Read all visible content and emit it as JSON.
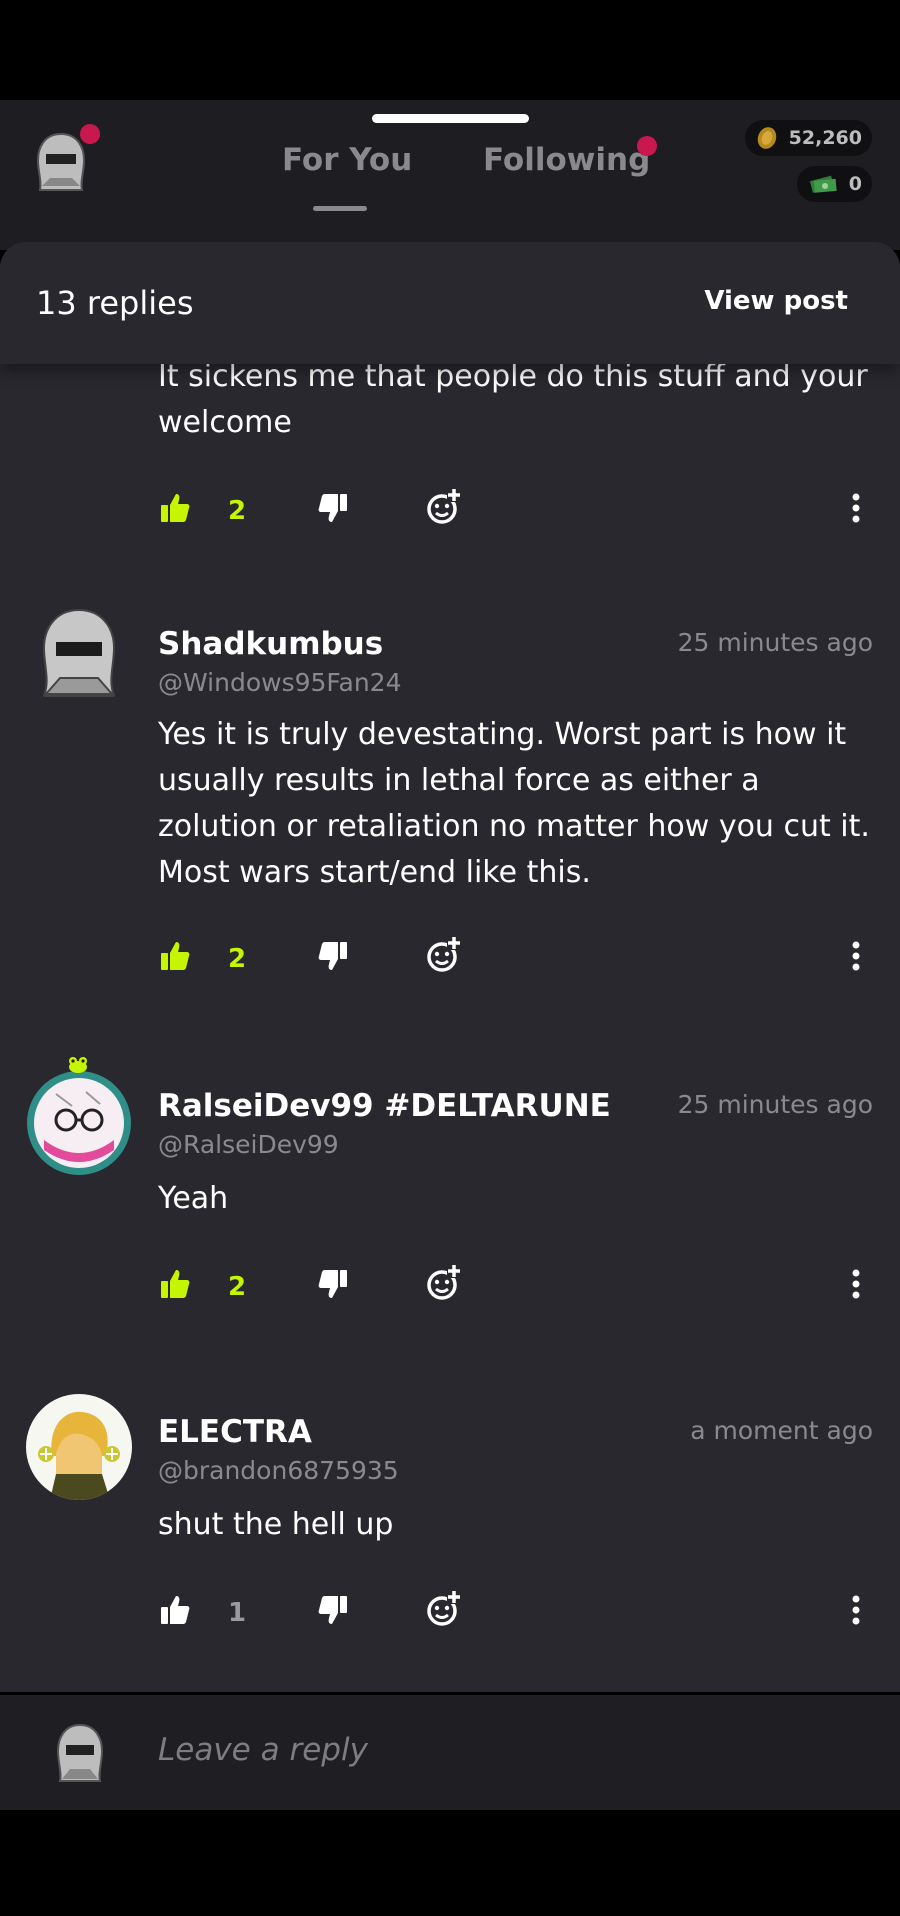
{
  "header": {
    "tabs": [
      {
        "label": "For You"
      },
      {
        "label": "Following"
      }
    ],
    "coins": "52,260",
    "cash": "0"
  },
  "sheet": {
    "replies_count": "13 replies",
    "view_post": "View post"
  },
  "comments": [
    {
      "body": "It sickens me that people do this stuff and your welcome",
      "likes": "2",
      "liked": true
    },
    {
      "name": "Shadkumbus",
      "handle": "@Windows95Fan24",
      "time": "25 minutes ago",
      "body": "Yes it is truly devestating. Worst part is how it usually results in lethal force as either a zolution or retaliation no matter how you cut it. Most wars start/end like this.",
      "likes": "2",
      "liked": true
    },
    {
      "name": "RalseiDev99 #DELTARUNE",
      "handle": "@RalseiDev99",
      "time": "25 minutes ago",
      "body": "Yeah",
      "likes": "2",
      "liked": true
    },
    {
      "name": "ELECTRA",
      "handle": "@brandon6875935",
      "time": "a moment ago",
      "body": "shut the hell up",
      "likes": "1",
      "liked": false
    }
  ],
  "reply_bar": {
    "placeholder": "Leave a reply"
  },
  "colors": {
    "accent_like": "#c6f500",
    "notification": "#c8184e",
    "sheet_bg": "#29282e"
  },
  "icons": [
    "thumbs-up-icon",
    "thumbs-down-icon",
    "emoji-add-icon",
    "more-vertical-icon",
    "coin-icon",
    "cash-icon"
  ]
}
